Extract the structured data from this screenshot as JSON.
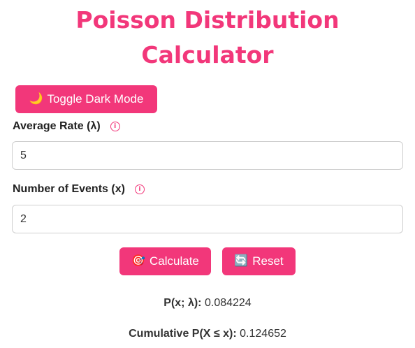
{
  "header": {
    "title_line1": "Poisson Distribution",
    "title_line2": "Calculator"
  },
  "toggle": {
    "icon": "🌙",
    "icon_name": "moon-icon",
    "label": "Toggle Dark Mode"
  },
  "fields": {
    "rate": {
      "label": "Average Rate (λ)",
      "value": "5",
      "info_icon": "info-icon"
    },
    "events": {
      "label": "Number of Events (x)",
      "value": "2",
      "info_icon": "info-icon"
    }
  },
  "actions": {
    "calculate": {
      "icon": "🎯",
      "icon_name": "target-icon",
      "label": "Calculate"
    },
    "reset": {
      "icon": "🔄",
      "icon_name": "refresh-icon",
      "label": "Reset"
    }
  },
  "results": {
    "pmf_label": "P(x; λ):",
    "pmf_value": "0.084224",
    "cdf_label": "Cumulative P(X ≤ x):",
    "cdf_value": "0.124652"
  },
  "colors": {
    "accent": "#f2377a",
    "text": "#222222",
    "input_border": "#cfcfcf"
  }
}
